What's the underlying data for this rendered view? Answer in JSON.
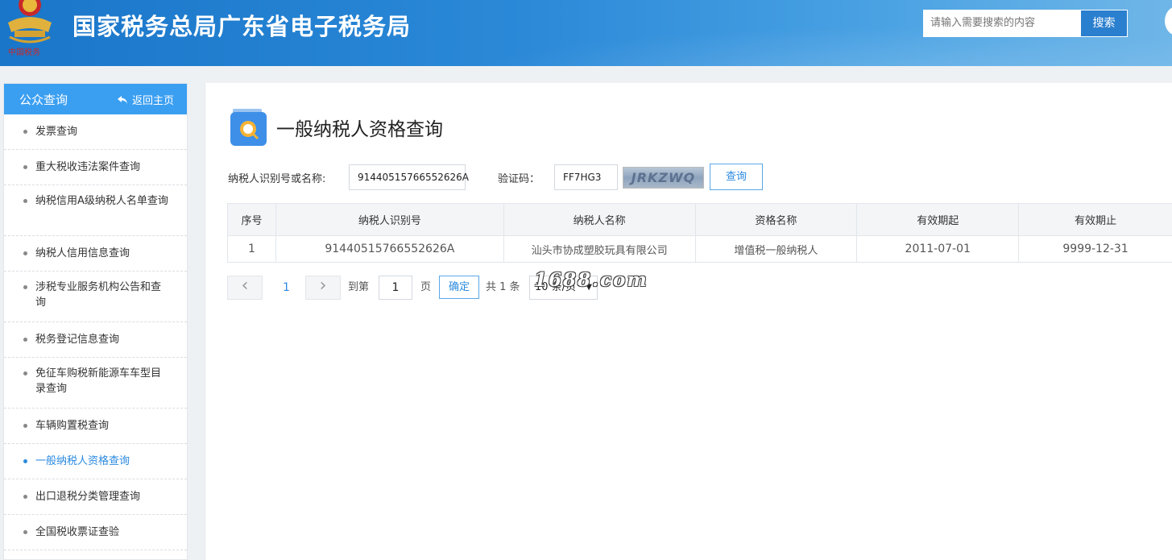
{
  "header": {
    "site_title": "国家税务总局广东省电子税务局",
    "search_placeholder": "请输入需要搜索的内容",
    "search_button": "搜索",
    "logo_text": "中国税务"
  },
  "sidebar": {
    "title": "公众查询",
    "back_label": "返回主页",
    "items": [
      {
        "label": "发票查询"
      },
      {
        "label": "重大税收违法案件查询"
      },
      {
        "label": "纳税信用A级纳税人名单查询"
      },
      {
        "label": "纳税人信用信息查询"
      },
      {
        "label": "涉税专业服务机构公告和查询"
      },
      {
        "label": "税务登记信息查询"
      },
      {
        "label": "免征车购税新能源车车型目录查询"
      },
      {
        "label": "车辆购置税查询"
      },
      {
        "label": "一般纳税人资格查询"
      },
      {
        "label": "出口退税分类管理查询"
      },
      {
        "label": "全国税收票证查验"
      }
    ],
    "active_index": 8
  },
  "main": {
    "page_title": "一般纳税人资格查询",
    "form": {
      "taxpayer_label": "纳税人识别号或名称:",
      "taxpayer_value": "91440515766552626A",
      "captcha_label": "验证码：",
      "captcha_value": "FF7HG3",
      "captcha_image_text": "JRKZWQ",
      "query_button": "查询"
    },
    "table": {
      "headers": [
        "序号",
        "纳税人识别号",
        "纳税人名称",
        "资格名称",
        "有效期起",
        "有效期止"
      ],
      "rows": [
        [
          "1",
          "91440515766552626A",
          "汕头市协成塑胶玩具有限公司",
          "增值税一般纳税人",
          "2011-07-01",
          "9999-12-31"
        ]
      ]
    },
    "pagination": {
      "prev": "‹",
      "current_page": "1",
      "next": "›",
      "goto_label": "到第",
      "goto_value": "1",
      "page_unit": "页",
      "confirm": "确定",
      "total": "共 1 条",
      "page_size": "10 条/页"
    },
    "watermark": "1688.com"
  }
}
